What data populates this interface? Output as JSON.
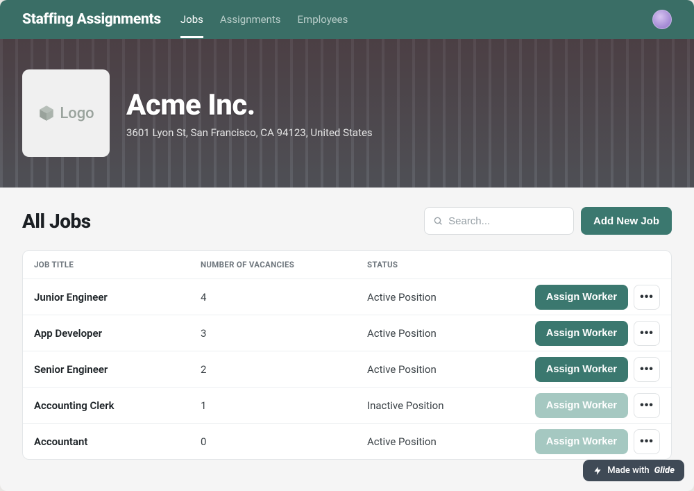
{
  "header": {
    "brand": "Staffing Assignments",
    "nav": [
      {
        "label": "Jobs",
        "active": true
      },
      {
        "label": "Assignments",
        "active": false
      },
      {
        "label": "Employees",
        "active": false
      }
    ]
  },
  "hero": {
    "logo_label": "Logo",
    "company_name": "Acme Inc.",
    "address": "3601 Lyon St, San Francisco, CA 94123, United States"
  },
  "jobs_section": {
    "title": "All Jobs",
    "search_placeholder": "Search...",
    "add_button": "Add New Job",
    "columns": {
      "title": "JOB TITLE",
      "vacancies": "NUMBER OF VACANCIES",
      "status": "STATUS"
    },
    "assign_label": "Assign Worker",
    "rows": [
      {
        "title": "Junior Engineer",
        "vacancies": "4",
        "status": "Active Position",
        "assign_enabled": true
      },
      {
        "title": "App Developer",
        "vacancies": "3",
        "status": "Active Position",
        "assign_enabled": true
      },
      {
        "title": "Senior Engineer",
        "vacancies": "2",
        "status": "Active Position",
        "assign_enabled": true
      },
      {
        "title": "Accounting Clerk",
        "vacancies": "1",
        "status": "Inactive Position",
        "assign_enabled": false
      },
      {
        "title": "Accountant",
        "vacancies": "0",
        "status": "Active Position",
        "assign_enabled": false
      }
    ]
  },
  "footer_badge": {
    "prefix": "Made with",
    "brand": "Glide"
  },
  "colors": {
    "primary": "#3b786f",
    "primary_disabled": "#a5c8c1",
    "topbar": "#3a6e66"
  }
}
